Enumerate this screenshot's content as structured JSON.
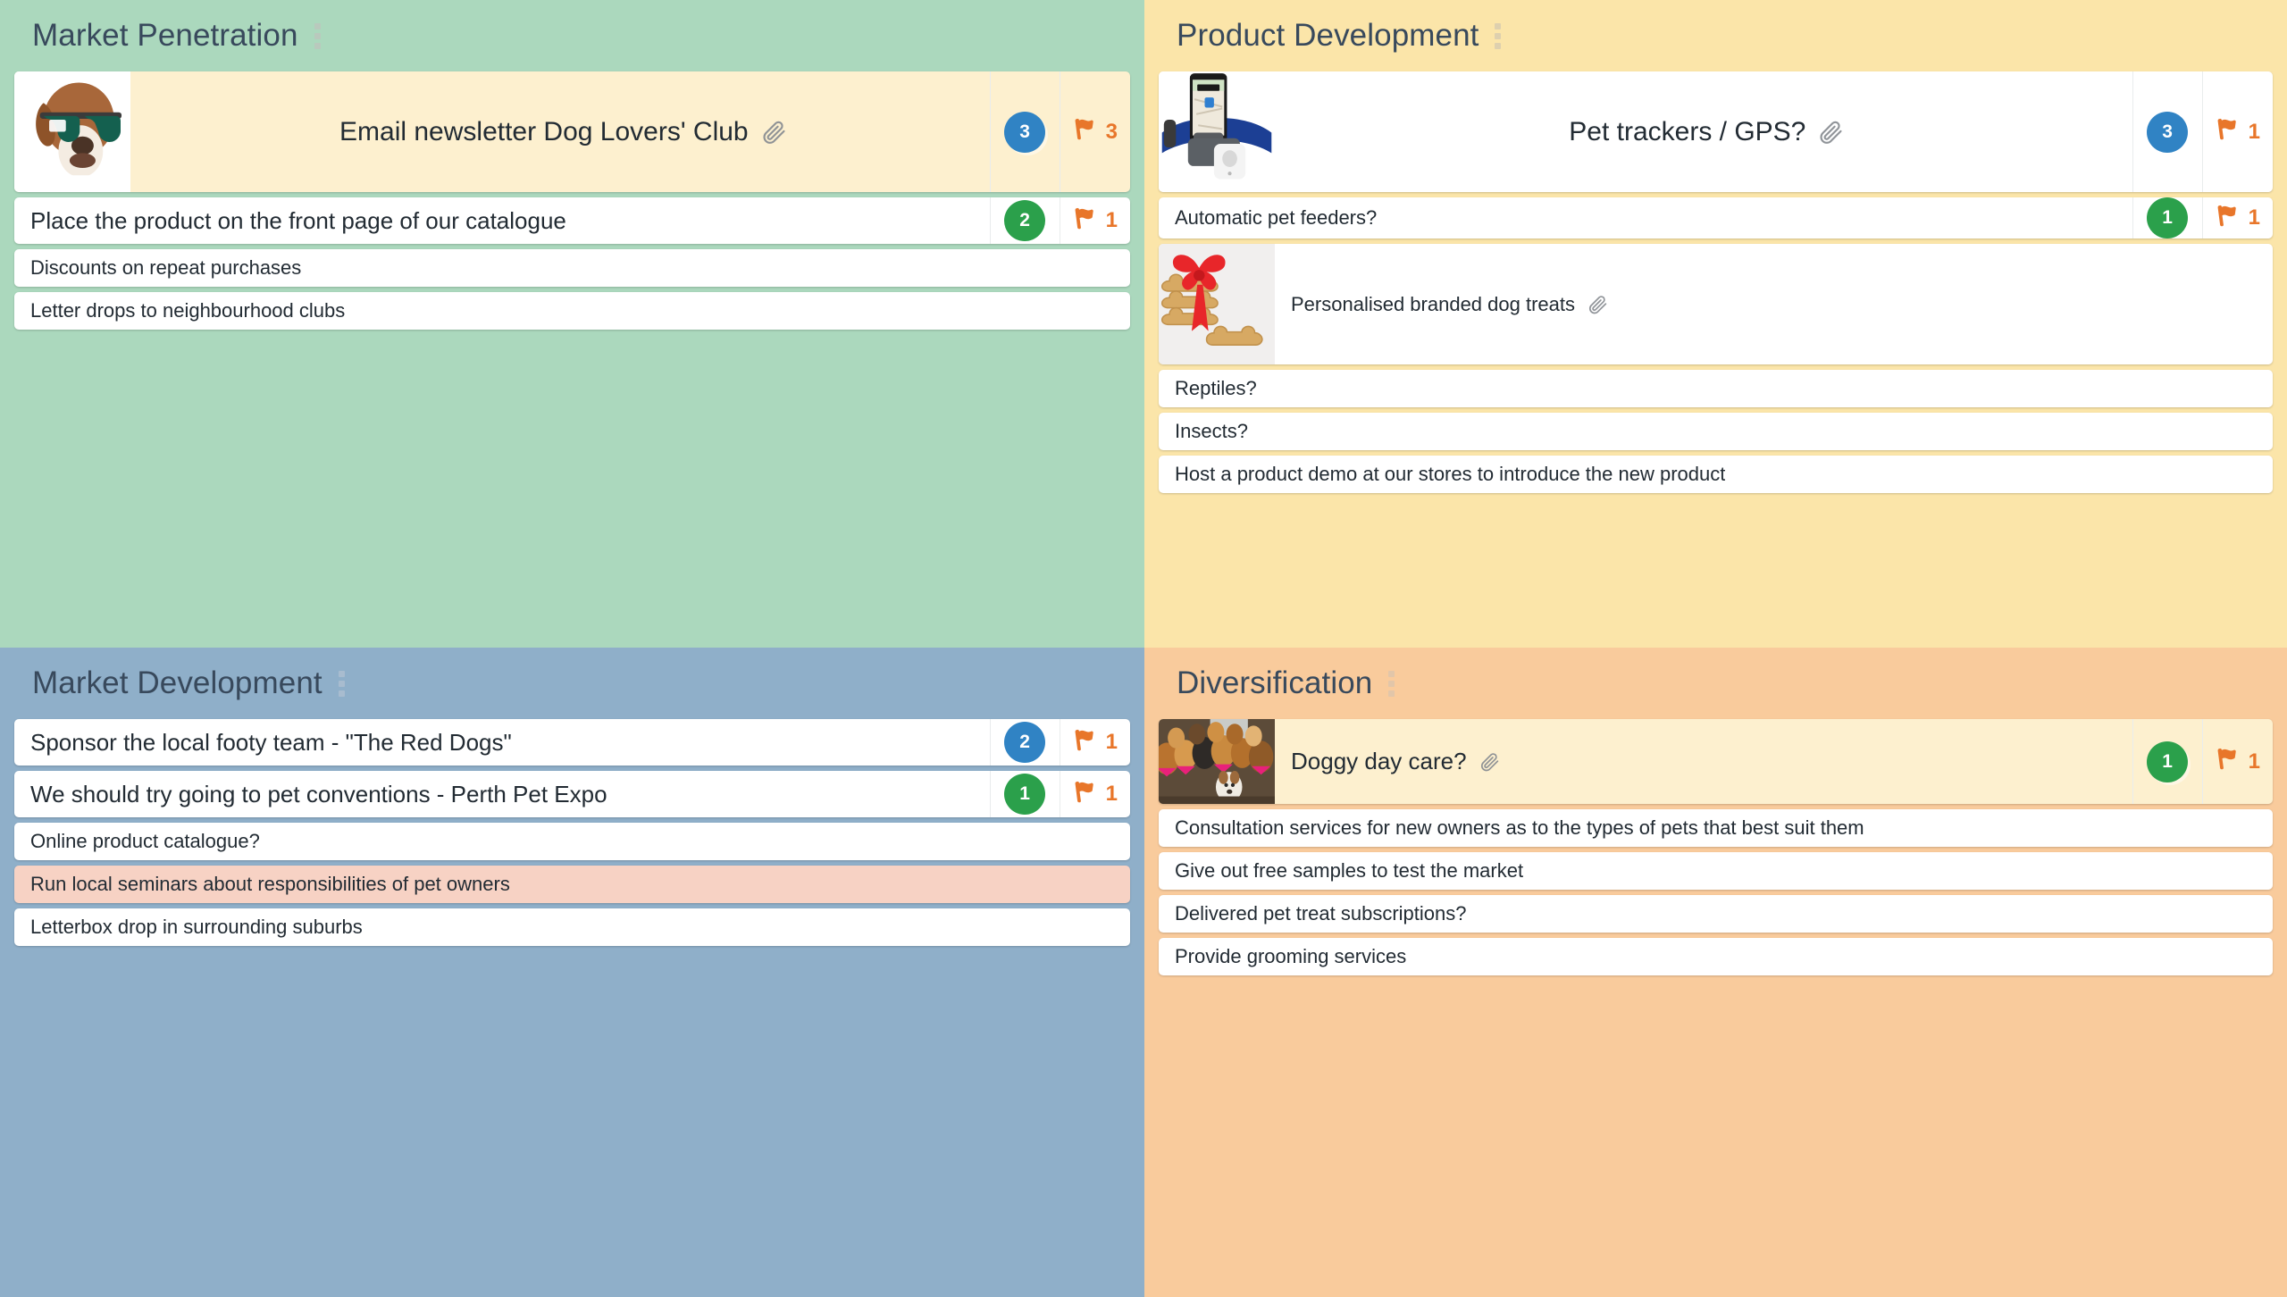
{
  "board": {
    "type": "ansoff-matrix",
    "colors": {
      "market_penetration_bg": "#abd8bd",
      "product_development_bg": "#fbe5a9",
      "market_development_bg": "#8fafc9",
      "diversification_bg": "#f9cb9c",
      "card_bg": "#ffffff",
      "card_highlight_yellow": "#fdf0cf",
      "card_highlight_pink": "#f7d2c4",
      "votes_blue": "#3083c4",
      "votes_green": "#2ba04b",
      "flag_orange": "#e8762a",
      "title_text": "#38495c"
    }
  },
  "quadrants": [
    {
      "id": "market-penetration",
      "title": "Market Penetration",
      "menu_icon": "kebab-menu-icon",
      "cards": [
        {
          "text": "Email newsletter Dog Lovers' Club",
          "size": "lg",
          "highlight": "yellow",
          "thumbnail": "dog-with-sunglasses",
          "has_attachment": true,
          "attachment_icon": "paperclip-icon",
          "votes": 3,
          "votes_color": "blue",
          "flags": 3,
          "flag_icon": "flag-icon"
        },
        {
          "text": "Place the product on the front page of our catalogue",
          "size": "md",
          "highlight": "none",
          "thumbnail": null,
          "has_attachment": false,
          "votes": 2,
          "votes_color": "green",
          "flags": 1,
          "flag_icon": "flag-icon"
        },
        {
          "text": "Discounts on repeat purchases",
          "size": "sm",
          "highlight": "none",
          "thumbnail": null,
          "has_attachment": false,
          "votes": null,
          "flags": null
        },
        {
          "text": "Letter drops to neighbourhood clubs",
          "size": "sm",
          "highlight": "none",
          "thumbnail": null,
          "has_attachment": false,
          "votes": null,
          "flags": null
        }
      ]
    },
    {
      "id": "product-development",
      "title": "Product Development",
      "menu_icon": "kebab-menu-icon",
      "cards": [
        {
          "text": "Pet trackers / GPS?",
          "size": "lg",
          "highlight": "none",
          "thumbnail": "gps-pet-collar",
          "has_attachment": true,
          "attachment_icon": "paperclip-icon",
          "votes": 3,
          "votes_color": "blue",
          "flags": 1,
          "flag_icon": "flag-icon"
        },
        {
          "text": "Automatic pet feeders?",
          "size": "sm",
          "highlight": "none",
          "thumbnail": null,
          "has_attachment": false,
          "votes": 1,
          "votes_color": "green",
          "flags": 1,
          "flag_icon": "flag-icon"
        },
        {
          "text": "Personalised branded dog treats",
          "size": "sm",
          "highlight": "none",
          "thumbnail": "dog-treats-with-bow",
          "has_attachment": true,
          "attachment_icon": "paperclip-icon",
          "votes": null,
          "flags": null
        },
        {
          "text": "Reptiles?",
          "size": "sm",
          "highlight": "none",
          "thumbnail": null,
          "has_attachment": false,
          "votes": null,
          "flags": null
        },
        {
          "text": "Insects?",
          "size": "sm",
          "highlight": "none",
          "thumbnail": null,
          "has_attachment": false,
          "votes": null,
          "flags": null
        },
        {
          "text": "Host a product demo at our stores to introduce the new product",
          "size": "sm",
          "highlight": "none",
          "thumbnail": null,
          "has_attachment": false,
          "votes": null,
          "flags": null
        }
      ]
    },
    {
      "id": "market-development",
      "title": "Market Development",
      "menu_icon": "kebab-menu-icon",
      "cards": [
        {
          "text": "Sponsor the local footy team - \"The Red Dogs\"",
          "size": "md",
          "highlight": "none",
          "thumbnail": null,
          "has_attachment": false,
          "votes": 2,
          "votes_color": "blue",
          "flags": 1,
          "flag_icon": "flag-icon"
        },
        {
          "text": "We should try going to pet conventions - Perth Pet Expo",
          "size": "md",
          "highlight": "none",
          "thumbnail": null,
          "has_attachment": false,
          "votes": 1,
          "votes_color": "green",
          "flags": 1,
          "flag_icon": "flag-icon"
        },
        {
          "text": "Online product catalogue?",
          "size": "sm",
          "highlight": "none",
          "thumbnail": null,
          "has_attachment": false,
          "votes": null,
          "flags": null
        },
        {
          "text": "Run local seminars about responsibilities of pet owners",
          "size": "sm",
          "highlight": "pink",
          "thumbnail": null,
          "has_attachment": false,
          "votes": null,
          "flags": null
        },
        {
          "text": "Letterbox drop in surrounding suburbs",
          "size": "sm",
          "highlight": "none",
          "thumbnail": null,
          "has_attachment": false,
          "votes": null,
          "flags": null
        }
      ]
    },
    {
      "id": "diversification",
      "title": "Diversification",
      "menu_icon": "kebab-menu-icon",
      "cards": [
        {
          "text": "Doggy day care?",
          "size": "md",
          "highlight": "yellow",
          "thumbnail": "group-of-dogs",
          "has_attachment": true,
          "attachment_icon": "paperclip-icon",
          "votes": 1,
          "votes_color": "green",
          "flags": 1,
          "flag_icon": "flag-icon"
        },
        {
          "text": "Consultation services for new owners as to the types of pets that best suit them",
          "size": "sm",
          "highlight": "none",
          "thumbnail": null,
          "has_attachment": false,
          "votes": null,
          "flags": null
        },
        {
          "text": "Give out free samples to test the market",
          "size": "sm",
          "highlight": "none",
          "thumbnail": null,
          "has_attachment": false,
          "votes": null,
          "flags": null
        },
        {
          "text": "Delivered pet treat subscriptions?",
          "size": "sm",
          "highlight": "none",
          "thumbnail": null,
          "has_attachment": false,
          "votes": null,
          "flags": null
        },
        {
          "text": "Provide grooming services",
          "size": "sm",
          "highlight": "none",
          "thumbnail": null,
          "has_attachment": false,
          "votes": null,
          "flags": null
        }
      ]
    }
  ]
}
